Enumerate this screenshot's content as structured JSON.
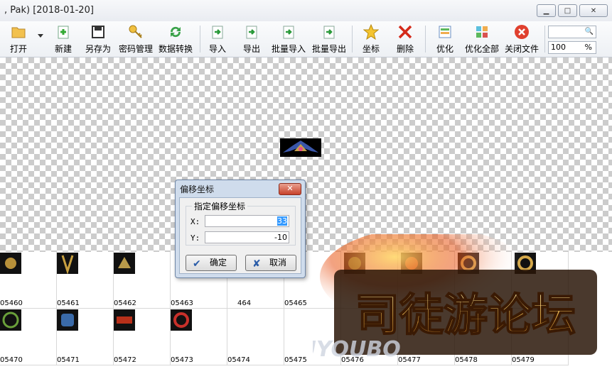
{
  "window": {
    "title": ", Pak) [2018-01-20]",
    "minimize": "▁",
    "maximize": "□",
    "close": "✕"
  },
  "toolbar": {
    "open": "打开",
    "new": "新建",
    "save_as": "另存为",
    "password": "密码管理",
    "convert": "数据转换",
    "import": "导入",
    "export": "导出",
    "batch_import": "批量导入",
    "batch_export": "批量导出",
    "coords": "坐标",
    "delete": "删除",
    "optimize": "优化",
    "optimize_all": "优化全部",
    "close_file": "关闭文件",
    "search_placeholder": "",
    "zoom_value": "100",
    "zoom_unit": "%"
  },
  "grid": {
    "row1": [
      "05460",
      "05461",
      "05462",
      "05463",
      "464",
      "05465"
    ],
    "row2": [
      "05470",
      "05471",
      "05472",
      "05473",
      "05474",
      "05475",
      "05476",
      "05477",
      "05478",
      "05479"
    ],
    "row1_right_partial": [
      "05477",
      "05479"
    ]
  },
  "dialog": {
    "title": "偏移坐标",
    "close": "✕",
    "group_label": "指定偏移坐标",
    "x_label": "X:",
    "x_value": "33",
    "y_label": "Y:",
    "y_value": "-10",
    "ok_label": "确定",
    "cancel_label": "取消"
  },
  "watermark": {
    "text": "司徒游论坛",
    "sub": "QUYOUBO"
  },
  "colors": {
    "accent": "#3399ff",
    "toolbar_bg": "#edf0f4",
    "dialog_bg": "#cfdcec"
  },
  "icons": {
    "open": "folder-icon",
    "new": "new-doc-icon",
    "save_as": "save-as-icon",
    "password": "key-icon",
    "convert": "convert-icon",
    "import": "import-icon",
    "coords": "star-icon",
    "delete": "delete-icon",
    "close_file": "close-file-icon"
  }
}
